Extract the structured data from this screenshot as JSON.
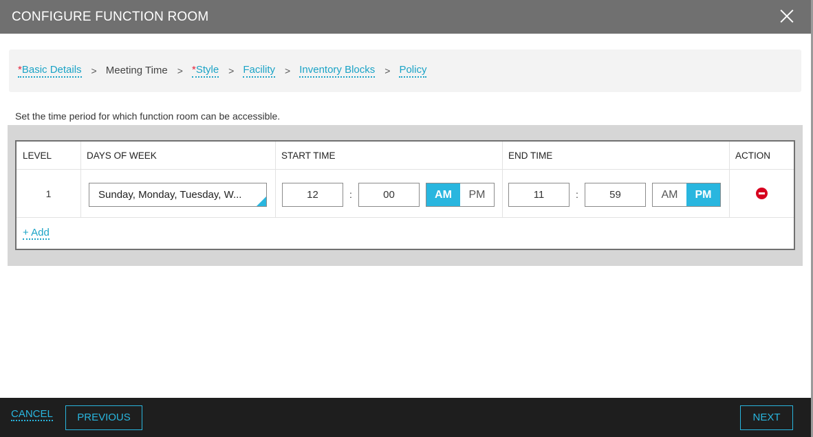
{
  "dialog": {
    "title": "CONFIGURE FUNCTION ROOM"
  },
  "breadcrumbs": {
    "required_mark": "*",
    "separator": ">",
    "items": [
      {
        "label": "Basic Details",
        "required": true
      },
      {
        "label": "Meeting Time",
        "required": false,
        "current": true
      },
      {
        "label": "Style",
        "required": true
      },
      {
        "label": "Facility",
        "required": false
      },
      {
        "label": "Inventory Blocks",
        "required": false
      },
      {
        "label": "Policy",
        "required": false
      }
    ]
  },
  "instructions": "Set the time period for which function room can be accessible.",
  "table": {
    "headers": {
      "level": "LEVEL",
      "days": "DAYS OF WEEK",
      "start": "START TIME",
      "end": "END TIME",
      "action": "ACTION"
    },
    "rows": [
      {
        "level": "1",
        "days": "Sunday, Monday, Tuesday, W...",
        "start": {
          "hour": "12",
          "minute": "00",
          "am": "AM",
          "pm": "PM",
          "selected": "AM"
        },
        "end": {
          "hour": "11",
          "minute": "59",
          "am": "AM",
          "pm": "PM",
          "selected": "PM"
        },
        "separator": ":"
      }
    ],
    "add_label": "+ Add"
  },
  "footer": {
    "cancel": "CANCEL",
    "previous": "PREVIOUS",
    "next": "NEXT"
  },
  "colors": {
    "accent": "#29b6df",
    "link": "#1aa3c6",
    "required": "#e3243b",
    "remove": "#d7001f",
    "titlebar": "#707070",
    "footer": "#1e1e1e"
  },
  "icons": {
    "close": "close-icon",
    "remove": "remove-circle-icon",
    "dropdown": "dropdown-corner-icon"
  }
}
